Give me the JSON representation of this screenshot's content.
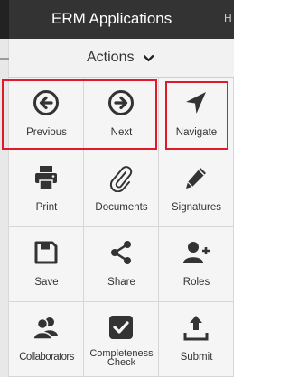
{
  "header": {
    "title": "ERM Applications",
    "overflow_text": "H"
  },
  "actions_menu": {
    "label": "Actions",
    "chevron_icon": "chevron-down-icon"
  },
  "buttons": [
    {
      "label": "Previous",
      "icon": "arrow-left-circle-icon"
    },
    {
      "label": "Next",
      "icon": "arrow-right-circle-icon"
    },
    {
      "label": "Navigate",
      "icon": "location-arrow-icon"
    },
    {
      "label": "Print",
      "icon": "printer-icon"
    },
    {
      "label": "Documents",
      "icon": "paperclip-icon"
    },
    {
      "label": "Signatures",
      "icon": "pencil-icon"
    },
    {
      "label": "Save",
      "icon": "floppy-disk-icon"
    },
    {
      "label": "Share",
      "icon": "share-icon"
    },
    {
      "label": "Roles",
      "icon": "user-plus-icon"
    },
    {
      "label": "Collaborators",
      "icon": "users-icon"
    },
    {
      "label": "Completeness Check",
      "icon": "checkbox-icon"
    },
    {
      "label": "Submit",
      "icon": "upload-icon"
    }
  ],
  "highlight_color": "#e0192b"
}
